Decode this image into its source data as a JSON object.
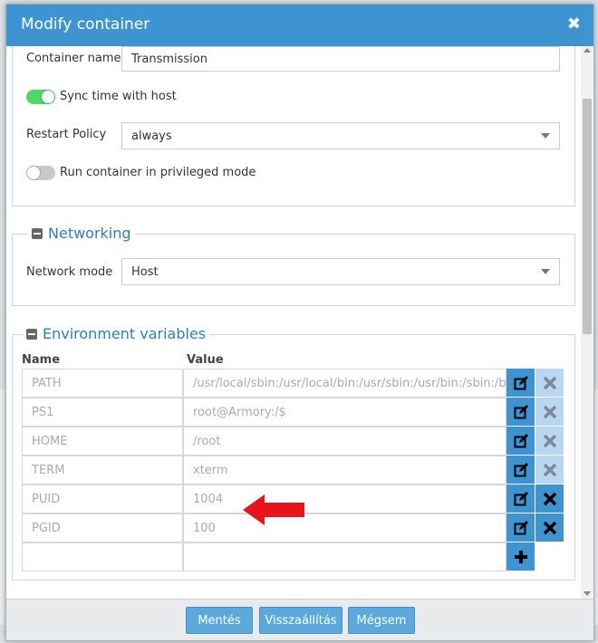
{
  "dialog": {
    "title": "Modify container",
    "close_glyph": "✖"
  },
  "general": {
    "container_name_label": "Container name",
    "container_name_value": "Transmission",
    "sync_time_label": "Sync time with host",
    "sync_time_on": true,
    "restart_policy_label": "Restart Policy",
    "restart_policy_value": "always",
    "privileged_label": "Run container in privileged mode",
    "privileged_on": false
  },
  "networking": {
    "legend": "Networking",
    "network_mode_label": "Network mode",
    "network_mode_value": "Host"
  },
  "environment": {
    "legend": "Environment variables",
    "col_name": "Name",
    "col_value": "Value",
    "rows": [
      {
        "name": "PATH",
        "value": "/usr/local/sbin:/usr/local/bin:/usr/sbin:/usr/bin:/sbin:/bi",
        "deletable": false
      },
      {
        "name": "PS1",
        "value": "root@Armory:/$",
        "deletable": false
      },
      {
        "name": "HOME",
        "value": "/root",
        "deletable": false
      },
      {
        "name": "TERM",
        "value": "xterm",
        "deletable": false
      },
      {
        "name": "PUID",
        "value": "1004",
        "deletable": true
      },
      {
        "name": "PGID",
        "value": "100",
        "deletable": true
      }
    ]
  },
  "footer": {
    "save_label": "Mentés",
    "reset_label": "Visszaállítás",
    "cancel_label": "Mégsem"
  },
  "colors": {
    "accent": "#3d94d0",
    "toggle_on": "#4cd964",
    "annotation_arrow": "#e8141b"
  }
}
